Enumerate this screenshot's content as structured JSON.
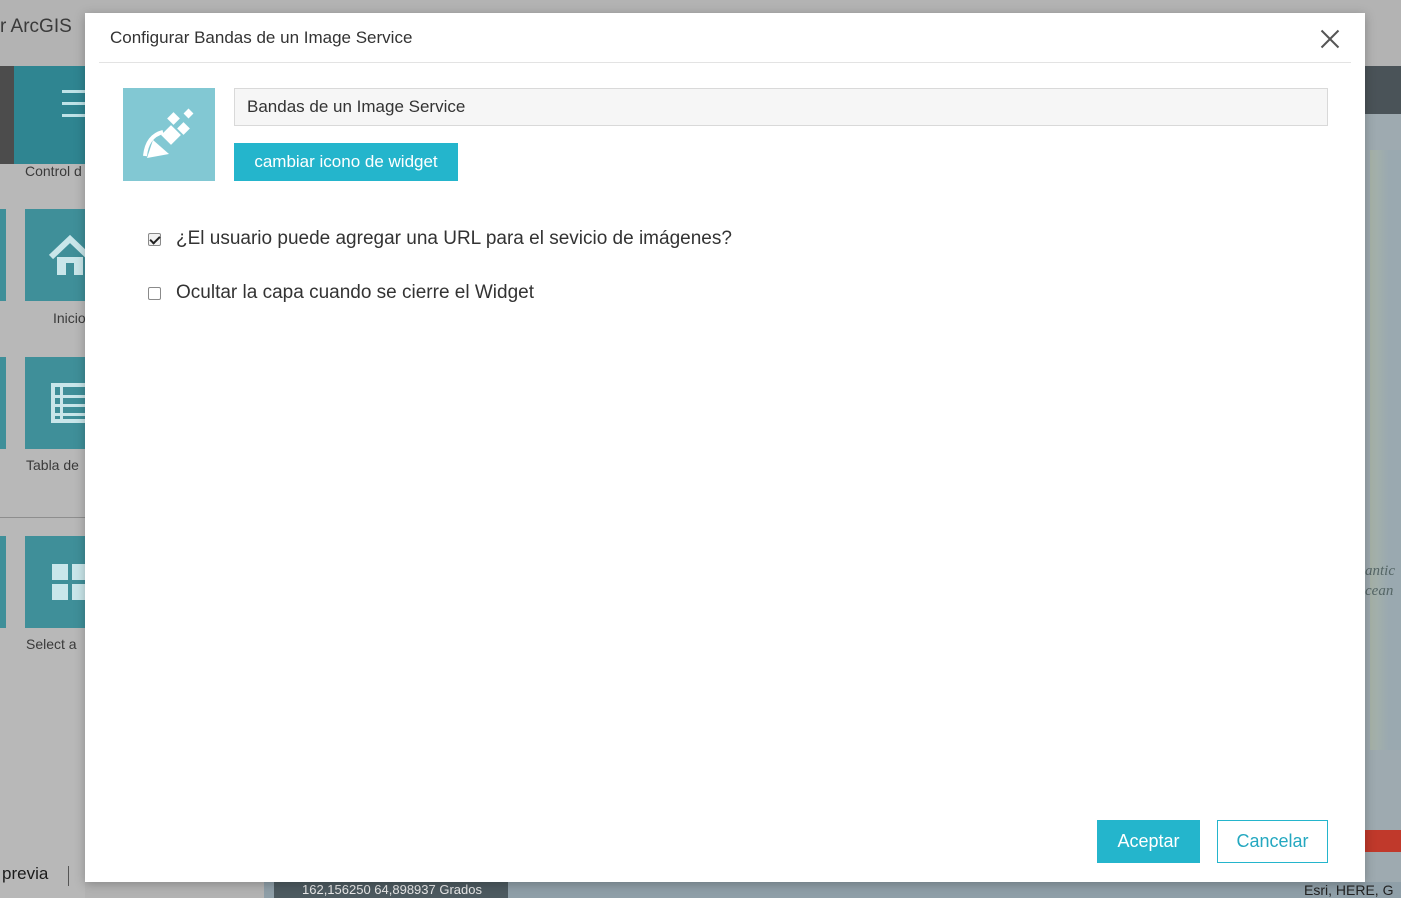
{
  "background": {
    "app_title": "r ArcGIS",
    "sidebar": {
      "items": [
        {
          "label": "Control d",
          "icon": "hamburger-icon"
        },
        {
          "label": "Inicio",
          "icon": "home-icon"
        },
        {
          "label": "Tabla de",
          "icon": "table-icon"
        },
        {
          "label": "Select a",
          "icon": "grid-icon"
        }
      ]
    },
    "footer": {
      "preview_label": "previa"
    },
    "map": {
      "coordinates": "162,156250 64,898937 Grados",
      "attribution": "Esri, HERE, G",
      "ocean_label_line1": "antic",
      "ocean_label_line2": "cean"
    }
  },
  "dialog": {
    "title": "Configurar Bandas de un Image Service",
    "widget_icon": "satellite-icon",
    "widget_name_value": "Bandas de un Image Service",
    "change_icon_label": "cambiar icono de widget",
    "options": [
      {
        "label": "¿El usuario puede agregar una URL para el sevicio de imágenes?",
        "checked": true
      },
      {
        "label": "Ocultar la capa cuando se cierre el Widget",
        "checked": false
      }
    ],
    "accept_label": "Aceptar",
    "cancel_label": "Cancelar"
  },
  "colors": {
    "accent": "#24b5cc",
    "icon_tile": "#82c8d3"
  }
}
